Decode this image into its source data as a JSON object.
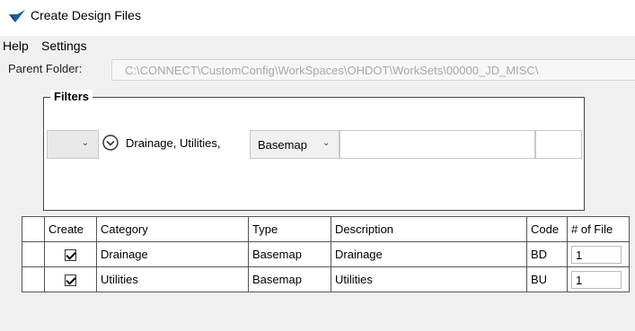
{
  "window": {
    "title": "Create Design Files",
    "icon": "app-logo-icon"
  },
  "menu": {
    "items": [
      "Help",
      "Settings"
    ]
  },
  "parent_folder": {
    "label": "Parent Folder:",
    "value": "C:\\CONNECT\\CustomConfig\\WorkSpaces\\OHDOT\\WorkSets\\00000_JD_MISC\\"
  },
  "filters": {
    "legend": "Filters",
    "selected_categories": "Drainage, Utilities,",
    "type_value": "Basemap"
  },
  "grid": {
    "columns": [
      "Create",
      "Category",
      "Type",
      "Description",
      "Code",
      "# of File"
    ],
    "rows": [
      {
        "create": true,
        "category": "Drainage",
        "type": "Basemap",
        "description": "Drainage",
        "code": "BD",
        "num_files": "1"
      },
      {
        "create": true,
        "category": "Utilities",
        "type": "Basemap",
        "description": "Utilities",
        "code": "BU",
        "num_files": "1"
      }
    ]
  }
}
